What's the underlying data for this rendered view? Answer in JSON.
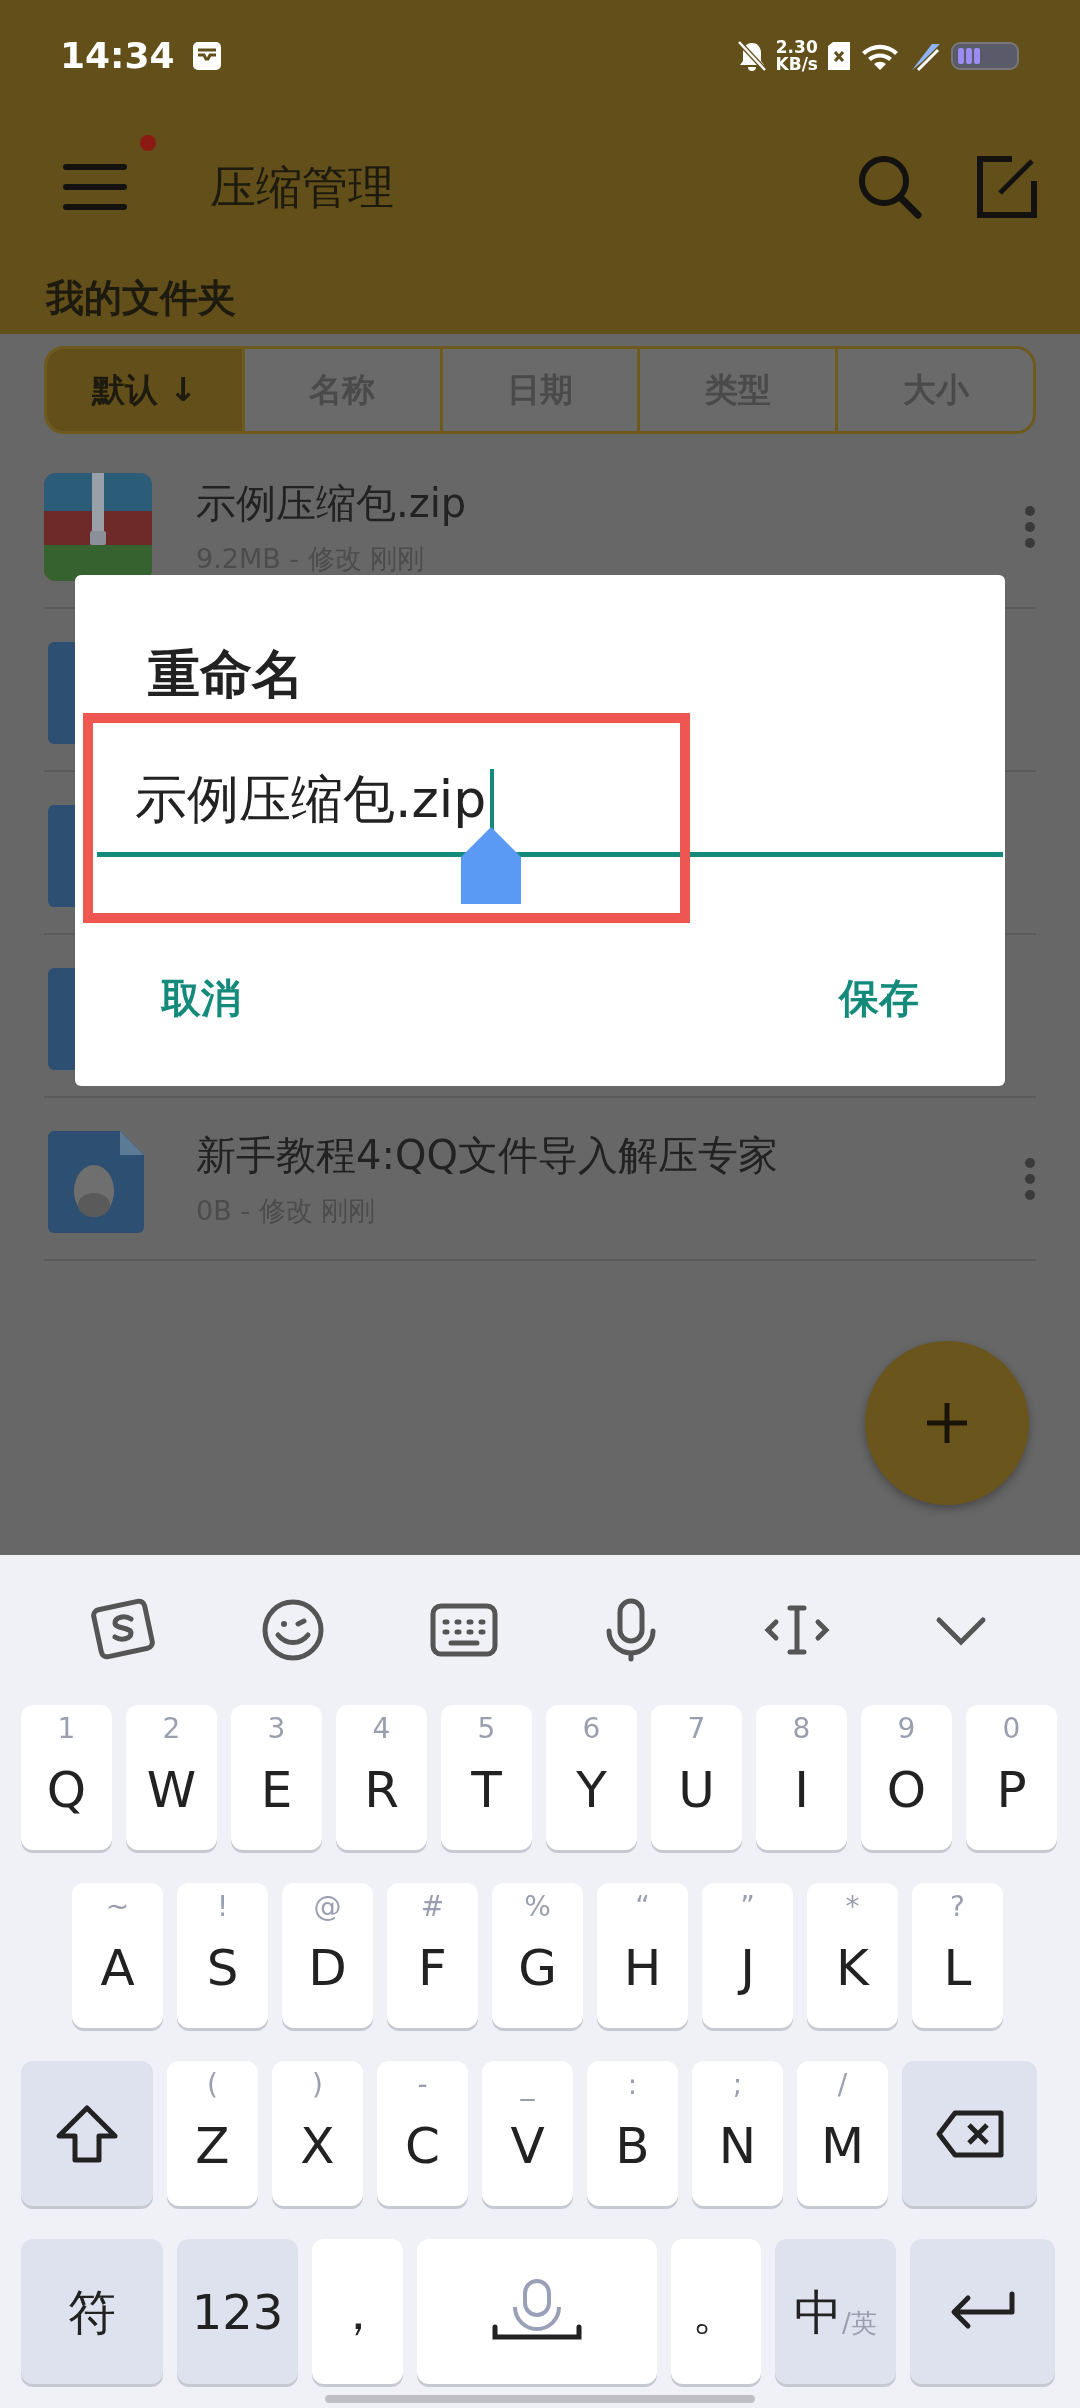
{
  "status_bar": {
    "time": "14:34",
    "net_speed": "2.30",
    "net_unit": "KB/s"
  },
  "app_bar": {
    "title": "压缩管理",
    "menu_badge": true
  },
  "section_title": "我的文件夹",
  "sort_tabs": [
    {
      "label": "默认 ↓",
      "selected": true
    },
    {
      "label": "名称",
      "selected": false
    },
    {
      "label": "日期",
      "selected": false
    },
    {
      "label": "类型",
      "selected": false
    },
    {
      "label": "大小",
      "selected": false
    }
  ],
  "files": [
    {
      "kind": "zip",
      "name": "示例压缩包.zip",
      "meta": "9.2MB - 修改 刚刚"
    },
    {
      "kind": "doc"
    },
    {
      "kind": "doc"
    },
    {
      "kind": "doc"
    },
    {
      "kind": "qq",
      "name": "新手教程4:QQ文件导入解压专家",
      "meta": "0B - 修改 刚刚"
    }
  ],
  "dialog": {
    "title": "重命名",
    "value": "示例压缩包.zip",
    "buttons": [
      "取消",
      "保存"
    ]
  },
  "keyboard": {
    "rows": [
      {
        "keys": [
          {
            "kind": "letter",
            "label": "Q",
            "hint": "1"
          },
          {
            "kind": "letter",
            "label": "W",
            "hint": "2"
          },
          {
            "kind": "letter",
            "label": "E",
            "hint": "3"
          },
          {
            "kind": "letter",
            "label": "R",
            "hint": "4"
          },
          {
            "kind": "letter",
            "label": "T",
            "hint": "5"
          },
          {
            "kind": "letter",
            "label": "Y",
            "hint": "6"
          },
          {
            "kind": "letter",
            "label": "U",
            "hint": "7"
          },
          {
            "kind": "letter",
            "label": "I",
            "hint": "8"
          },
          {
            "kind": "letter",
            "label": "O",
            "hint": "9"
          },
          {
            "kind": "letter",
            "label": "P",
            "hint": "0"
          }
        ]
      },
      {
        "keys": [
          {
            "kind": "letter",
            "label": "A",
            "hint": "~"
          },
          {
            "kind": "letter",
            "label": "S",
            "hint": "!"
          },
          {
            "kind": "letter",
            "label": "D",
            "hint": "@"
          },
          {
            "kind": "letter",
            "label": "F",
            "hint": "#"
          },
          {
            "kind": "letter",
            "label": "G",
            "hint": "%"
          },
          {
            "kind": "letter",
            "label": "H",
            "hint": "“"
          },
          {
            "kind": "letter",
            "label": "J",
            "hint": "”"
          },
          {
            "kind": "letter",
            "label": "K",
            "hint": "*"
          },
          {
            "kind": "letter",
            "label": "L",
            "hint": "?"
          }
        ]
      },
      {
        "keys": [
          {
            "kind": "shift"
          },
          {
            "kind": "letter",
            "label": "Z",
            "hint": "("
          },
          {
            "kind": "letter",
            "label": "X",
            "hint": ")"
          },
          {
            "kind": "letter",
            "label": "C",
            "hint": "-"
          },
          {
            "kind": "letter",
            "label": "V",
            "hint": "_"
          },
          {
            "kind": "letter",
            "label": "B",
            "hint": ":"
          },
          {
            "kind": "letter",
            "label": "N",
            "hint": ";"
          },
          {
            "kind": "letter",
            "label": "M",
            "hint": "/"
          },
          {
            "kind": "backspace"
          }
        ]
      },
      {
        "keys": [
          {
            "kind": "func",
            "label": "符"
          },
          {
            "kind": "func",
            "label": "123"
          },
          {
            "kind": "punct",
            "label": "，"
          },
          {
            "kind": "space"
          },
          {
            "kind": "punct",
            "label": "。"
          },
          {
            "kind": "lang",
            "label": "中",
            "sub": "/英"
          },
          {
            "kind": "enter"
          }
        ]
      }
    ]
  }
}
